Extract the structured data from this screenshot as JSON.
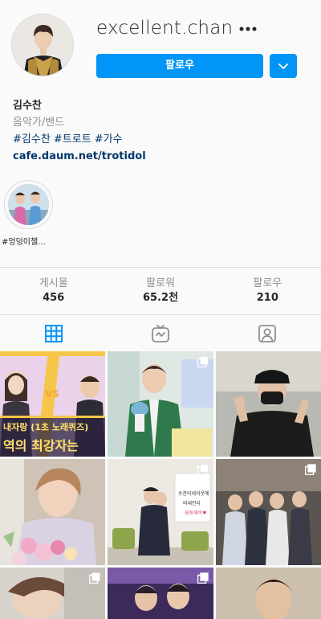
{
  "profile": {
    "username": "excellent.chan",
    "follow_label": "팔로우"
  },
  "bio": {
    "name": "김수찬",
    "category": "음악가/밴드",
    "hashtags": "#김수찬 #트로트 #가수",
    "link": "cafe.daum.net/trotidol"
  },
  "highlights": [
    {
      "label": "#엉덩이챌..."
    }
  ],
  "stats": [
    {
      "label": "게시물",
      "value": "456"
    },
    {
      "label": "팔로워",
      "value": "65.2천"
    },
    {
      "label": "팔로우",
      "value": "210"
    }
  ],
  "tabs": [
    {
      "name": "posts",
      "icon": "grid-icon",
      "active": true
    },
    {
      "name": "igtv",
      "icon": "igtv-icon",
      "active": false
    },
    {
      "name": "tagged",
      "icon": "tagged-icon",
      "active": false
    }
  ],
  "grid_posts": [
    {
      "overlay_text_1": "내자랑 (1초 노래퀴즈)",
      "overlay_text_2": "역의 최강자는",
      "vs": "VS",
      "multi": false
    },
    {
      "multi": true
    },
    {
      "multi": false
    },
    {
      "multi": false
    },
    {
      "sign_text_1": "수찬이네이웃에",
      "sign_text_2": "비내린다",
      "sign_text_3": "쉼동애비♥",
      "multi": true
    },
    {
      "multi": true
    },
    {
      "multi": true
    },
    {
      "multi": true
    },
    {
      "multi": false
    }
  ],
  "colors": {
    "accent": "#0095f6",
    "active_tab": "#0095f6",
    "link": "#00376b",
    "muted": "#8e8e8e"
  }
}
